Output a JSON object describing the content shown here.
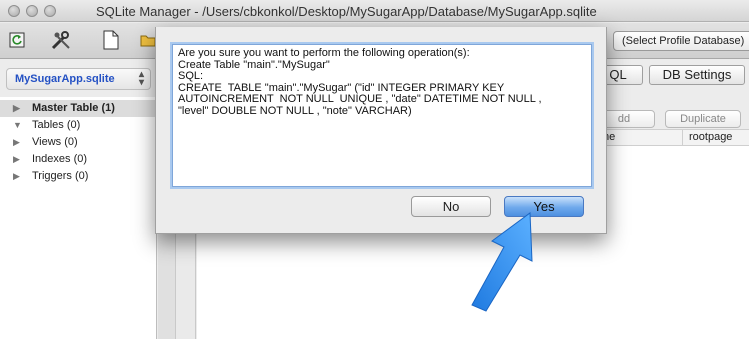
{
  "window": {
    "title": "SQLite Manager - /Users/cbkonkol/Desktop/MySugarApp/Database/MySugarApp.sqlite"
  },
  "toolbar": {
    "profile_select": "(Select Profile Database)"
  },
  "sidebar": {
    "db_name": "MySugarApp.sqlite",
    "items": [
      {
        "label": "Master Table (1)",
        "disclosure": "▶"
      },
      {
        "label": "Tables (0)",
        "disclosure": "▼"
      },
      {
        "label": "Views (0)",
        "disclosure": "▶"
      },
      {
        "label": "Indexes (0)",
        "disclosure": "▶"
      },
      {
        "label": "Triggers (0)",
        "disclosure": "▶"
      }
    ]
  },
  "main": {
    "tabs": [
      "QL",
      "DB Settings"
    ],
    "actions": [
      "dd",
      "Duplicate"
    ],
    "columns": [
      "me",
      "rootpage"
    ]
  },
  "dialog": {
    "message": "Are you sure you want to perform the following operation(s):\nCreate Table \"main\".\"MySugar\"\nSQL:\nCREATE  TABLE \"main\".\"MySugar\" (\"id\" INTEGER PRIMARY KEY\nAUTOINCREMENT  NOT NULL  UNIQUE , \"date\" DATETIME NOT NULL ,\n\"level\" DOUBLE NOT NULL , \"note\" VARCHAR)",
    "no_label": "No",
    "yes_label": "Yes"
  },
  "colors": {
    "arrow": "#2e8ef0",
    "db_name": "#2451c4"
  }
}
